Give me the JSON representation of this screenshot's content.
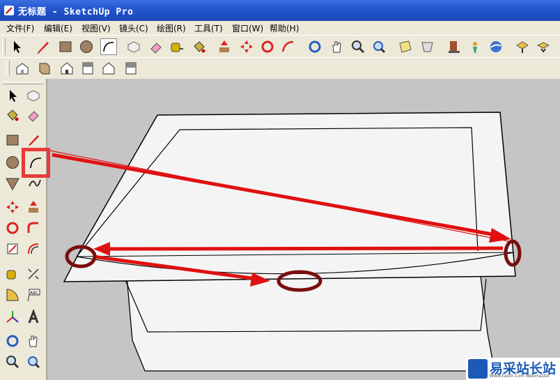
{
  "window": {
    "title": "无标题 - SketchUp Pro"
  },
  "menu": [
    {
      "label": "文件(F)"
    },
    {
      "label": "编辑(E)"
    },
    {
      "label": "视图(V)"
    },
    {
      "label": "镜头(C)"
    },
    {
      "label": "绘图(R)"
    },
    {
      "label": "工具(T)"
    },
    {
      "label": "窗口(W)"
    },
    {
      "label": "帮助(H)"
    }
  ],
  "toolbar_main": [
    "select-icon",
    "line-pencil-icon",
    "rectangle-icon",
    "circle-icon",
    "arc-icon",
    "eraser-icon",
    "paint-bucket-icon",
    "tape-measure-icon",
    "push-pull-icon",
    "move-icon",
    "rotate-icon",
    "follow-me-icon",
    "orbit-icon",
    "pan-icon",
    "zoom-icon",
    "zoom-extents-icon",
    "section-plane-icon",
    "components-icon",
    "geo-location-icon",
    "get-models-icon",
    "share-model-icon",
    "extension-icon"
  ],
  "toolbar_views": [
    "iso-view-icon",
    "top-view-icon",
    "front-view-icon",
    "right-view-icon",
    "back-view-icon",
    "left-view-icon"
  ],
  "left_toolbar": [
    "select-icon",
    "make-component-icon",
    "paint-bucket-icon",
    "eraser-icon",
    "rectangle-icon",
    "line-pencil-icon",
    "circle-icon",
    "arc-icon",
    "polygon-icon",
    "freehand-icon",
    "move-icon",
    "push-pull-icon",
    "rotate-icon",
    "follow-me-icon",
    "scale-icon",
    "offset-icon",
    "tape-measure-icon",
    "dimension-icon",
    "protractor-icon",
    "text-icon",
    "axes-icon",
    "3d-text-icon",
    "orbit-icon",
    "pan-icon",
    "zoom-icon",
    "zoom-window-icon"
  ],
  "highlighted_tool": "arc-icon",
  "annotation_color": "#e01010",
  "watermark": {
    "text": "易采站长站",
    "sub": "Www.Easck.Com Webmaster"
  }
}
